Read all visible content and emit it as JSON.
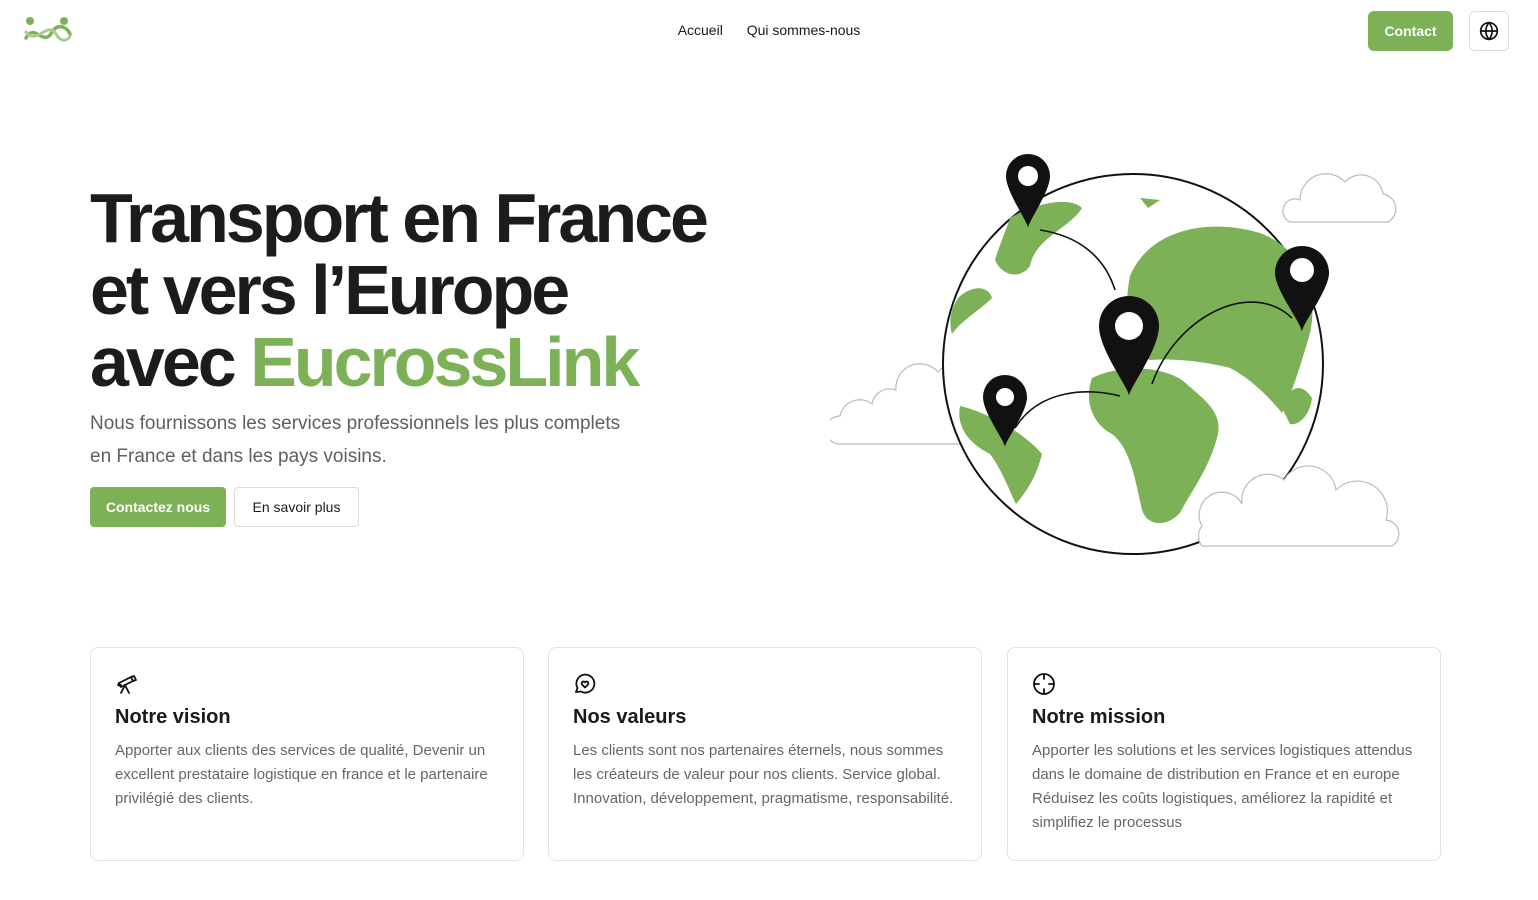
{
  "brand": {
    "logo_icon": "eucrosslink-logo-icon",
    "accent_color": "#7cb157"
  },
  "nav": {
    "items": [
      {
        "label": "Accueil"
      },
      {
        "label": "Qui sommes-nous"
      }
    ],
    "contact_label": "Contact",
    "language_icon": "globe-icon"
  },
  "hero": {
    "title_line1": "Transport en France",
    "title_line2": "et vers l’Europe",
    "title_line3_prefix": "avec ",
    "title_line3_accent": "EucrossLink",
    "subtitle_line1": "Nous fournissons les services professionnels les plus complets",
    "subtitle_line2": "en France et dans les pays voisins.",
    "cta_primary": "Contactez nous",
    "cta_secondary": "En savoir plus",
    "illustration": "globe-with-map-pins-illustration"
  },
  "cards": [
    {
      "icon": "telescope-icon",
      "title": "Notre vision",
      "text": "Apporter aux clients des services de qualité, Devenir un excellent prestataire logistique en france et le partenaire privilégié des clients."
    },
    {
      "icon": "heart-chat-icon",
      "title": "Nos valeurs",
      "text": "Les clients sont nos partenaires éternels, nous sommes les créateurs de valeur pour nos clients. Service global. Innovation, développement, pragmatisme, responsabilité."
    },
    {
      "icon": "crosshair-icon",
      "title": "Notre mission",
      "text": "Apporter les solutions et les services logistiques attendus dans le domaine de distribution en France et en europe Réduisez les coûts logistiques, améliorez la rapidité et simplifiez le processus"
    }
  ]
}
